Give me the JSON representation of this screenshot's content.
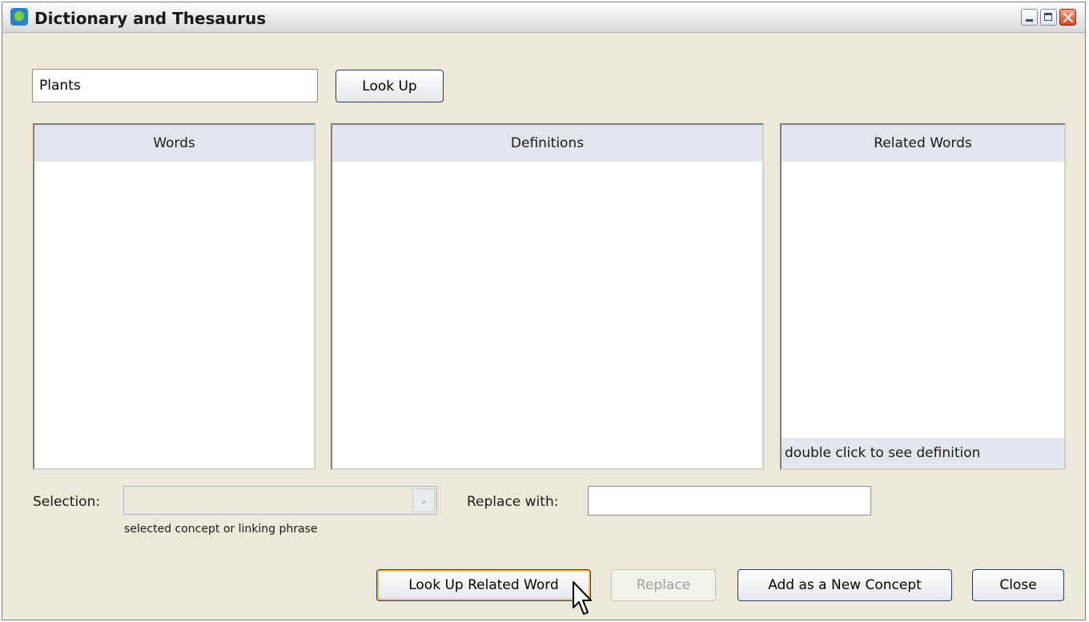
{
  "window": {
    "title": "Dictionary and Thesaurus",
    "controls": {
      "minimize": "minimize-icon",
      "maximize": "maximize-icon",
      "close": "close-icon"
    }
  },
  "search": {
    "value": "Plants",
    "button_label": "Look Up"
  },
  "panels": {
    "words": {
      "header": "Words",
      "items": []
    },
    "definitions": {
      "header": "Definitions",
      "items": []
    },
    "related": {
      "header": "Related Words",
      "items": [],
      "footer": "double click to see definition"
    }
  },
  "selection": {
    "label": "Selection:",
    "value": "",
    "helper": "selected concept or linking phrase"
  },
  "replace": {
    "label": "Replace with:",
    "value": ""
  },
  "buttons": {
    "look_up_related": "Look Up Related Word",
    "replace": "Replace",
    "add_concept": "Add as a New Concept",
    "close": "Close"
  },
  "colors": {
    "window_bg": "#ece9d8",
    "panel_header_bg": "#e2e6ec",
    "button_border": "#1f3c6d",
    "focus_ring": "#f4b94a"
  }
}
